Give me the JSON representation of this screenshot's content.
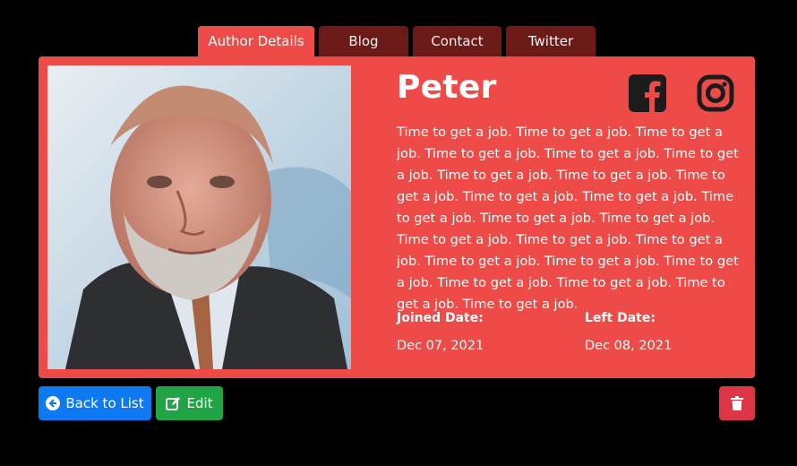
{
  "tabs": [
    {
      "label": "Author Details",
      "active": true
    },
    {
      "label": "Blog",
      "active": false
    },
    {
      "label": "Contact",
      "active": false
    },
    {
      "label": "Twitter",
      "active": false
    }
  ],
  "author": {
    "name": "Peter",
    "bio": "Time to get a job. Time to get a job. Time to get a job. Time to get a job. Time to get a job. Time to get a job. Time to get a job. Time to get a job. Time to get a job. Time to get a job. Time to get a job. Time to get a job. Time to get a job. Time to get a job. Time to get a job. Time to get a job. Time to get a job. Time to get a job. Time to get a job. Time to get a job. Time to get a job. Time to get a job. Time to get a job. Time to get a job.",
    "joined_label": "Joined Date:",
    "joined_value": "Dec 07, 2021",
    "left_label": "Left Date:",
    "left_value": "Dec 08, 2021"
  },
  "social_icons": [
    "facebook-icon",
    "instagram-icon"
  ],
  "actions": {
    "back_label": "Back to List",
    "edit_label": "Edit",
    "delete_icon": "trash-icon"
  },
  "colors": {
    "card": "#ee4b48",
    "tab_inactive": "#6b1a18",
    "back_button": "#0d79f2",
    "edit_button": "#21a445",
    "delete_button": "#dc3545"
  }
}
